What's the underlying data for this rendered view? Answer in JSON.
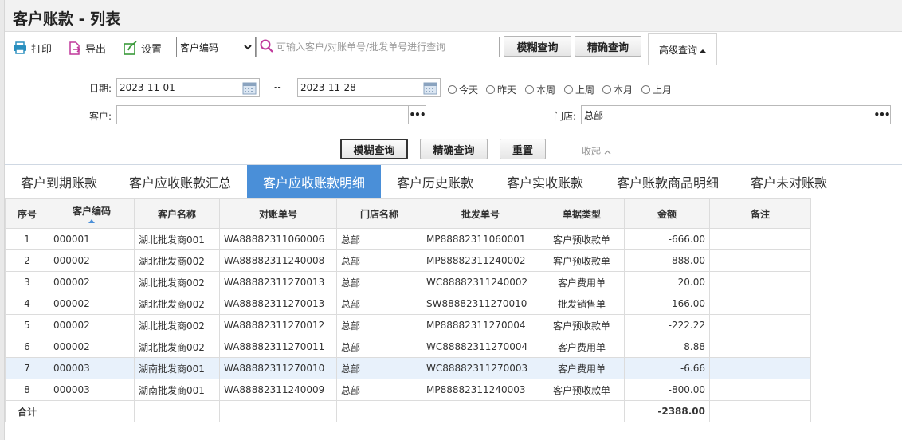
{
  "page_title": "客户账款 - 列表",
  "toolbar": {
    "print_label": "打印",
    "export_label": "导出",
    "settings_label": "设置",
    "search_field_selected": "客户编码",
    "search_placeholder": "可输入客户/对账单号/批发单号进行查询",
    "fuzzy_btn": "模糊查询",
    "exact_btn": "精确查询",
    "advanced_tab": "高级查询"
  },
  "filters": {
    "date_label": "日期:",
    "date_from": "2023-11-01",
    "date_sep": "--",
    "date_to": "2023-11-28",
    "quick_dates": [
      "今天",
      "昨天",
      "本周",
      "上周",
      "本月",
      "上月"
    ],
    "customer_label": "客户:",
    "customer_value": "",
    "store_label": "门店:",
    "store_value": "总部",
    "fuzzy_btn": "模糊查询",
    "exact_btn": "精确查询",
    "reset_btn": "重置",
    "collapse_label": "收起"
  },
  "tabs": [
    "客户到期账款",
    "客户应收账款汇总",
    "客户应收账款明细",
    "客户历史账款",
    "客户实收账款",
    "客户账款商品明细",
    "客户未对账款"
  ],
  "active_tab": 2,
  "table": {
    "headers": [
      "序号",
      "客户编码",
      "客户名称",
      "对账单号",
      "门店名称",
      "批发单号",
      "单据类型",
      "金额",
      "备注"
    ],
    "rows": [
      {
        "no": "1",
        "code": "000001",
        "name": "湖北批发商001",
        "statement": "WA88882311060006",
        "store": "总部",
        "wholesale": "MP88882311060001",
        "type": "客户预收款单",
        "amount": "-666.00",
        "remark": ""
      },
      {
        "no": "2",
        "code": "000002",
        "name": "湖北批发商002",
        "statement": "WA88882311240008",
        "store": "总部",
        "wholesale": "MP88882311240002",
        "type": "客户预收款单",
        "amount": "-888.00",
        "remark": ""
      },
      {
        "no": "3",
        "code": "000002",
        "name": "湖北批发商002",
        "statement": "WA88882311270013",
        "store": "总部",
        "wholesale": "WC88882311240002",
        "type": "客户费用单",
        "amount": "20.00",
        "remark": ""
      },
      {
        "no": "4",
        "code": "000002",
        "name": "湖北批发商002",
        "statement": "WA88882311270013",
        "store": "总部",
        "wholesale": "SW88882311270010",
        "type": "批发销售单",
        "amount": "166.00",
        "remark": ""
      },
      {
        "no": "5",
        "code": "000002",
        "name": "湖北批发商002",
        "statement": "WA88882311270012",
        "store": "总部",
        "wholesale": "MP88882311270004",
        "type": "客户预收款单",
        "amount": "-222.22",
        "remark": ""
      },
      {
        "no": "6",
        "code": "000002",
        "name": "湖北批发商002",
        "statement": "WA88882311270011",
        "store": "总部",
        "wholesale": "WC88882311270004",
        "type": "客户费用单",
        "amount": "8.88",
        "remark": ""
      },
      {
        "no": "7",
        "code": "000003",
        "name": "湖南批发商001",
        "statement": "WA88882311270010",
        "store": "总部",
        "wholesale": "WC88882311270003",
        "type": "客户费用单",
        "amount": "-6.66",
        "remark": ""
      },
      {
        "no": "8",
        "code": "000003",
        "name": "湖南批发商001",
        "statement": "WA88882311240009",
        "store": "总部",
        "wholesale": "MP88882311240003",
        "type": "客户预收款单",
        "amount": "-800.00",
        "remark": ""
      }
    ],
    "highlighted_row": 6,
    "total_label": "合计",
    "total_amount": "-2388.00"
  },
  "colors": {
    "accent": "#4a8fd8",
    "link": "#2e73b8",
    "print_icon": "#2a8fbf",
    "export_icon": "#c0399b",
    "settings_icon": "#3a9a3a",
    "search_icon": "#c0399b"
  },
  "icons": [
    "printer-icon",
    "export-icon",
    "settings-icon",
    "search-icon",
    "calendar-icon",
    "chevron-down-icon",
    "caret-up-icon",
    "ellipsis-icon",
    "sort-asc-icon"
  ]
}
